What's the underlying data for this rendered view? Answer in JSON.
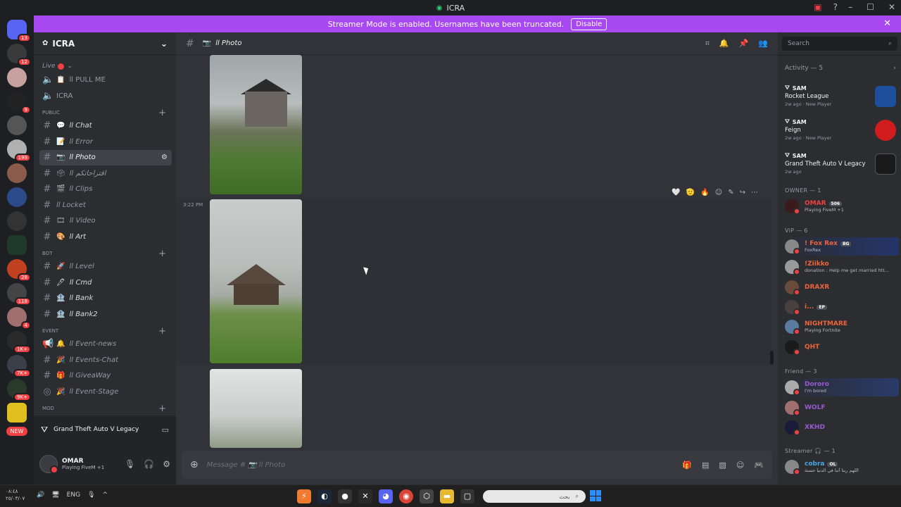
{
  "window": {
    "title": "ICRA"
  },
  "banner": {
    "text": "Streamer Mode is enabled. Usernames have been truncated.",
    "button": "Disable"
  },
  "guild_badges": [
    "13",
    "12",
    "9",
    "199",
    "28",
    "118",
    "4",
    "1K+",
    "7K+",
    "9K+"
  ],
  "guild_new": "NEW",
  "server": {
    "name": "ICRA"
  },
  "sidebar": {
    "live": {
      "label": "Live"
    },
    "voice": [
      {
        "label": "ll PULL ME"
      },
      {
        "label": "ICRA"
      }
    ],
    "public_cat": "PUBLIC",
    "public": [
      {
        "label": "ll Chat",
        "emoji": "💬"
      },
      {
        "label": "ll Error",
        "emoji": "📝"
      },
      {
        "label": "ll Photo",
        "emoji": "📷"
      },
      {
        "label": "ll اقتراحاتكم",
        "emoji": "🗳"
      },
      {
        "label": "ll Clips",
        "emoji": "🎬"
      },
      {
        "label": "ll Locket",
        "emoji": "🖼"
      },
      {
        "label": "ll Video",
        "emoji": "🎞"
      },
      {
        "label": "ll Art",
        "emoji": "🎨"
      }
    ],
    "bot_cat": "BOT",
    "bot": [
      {
        "label": "ll Level",
        "emoji": "🚀"
      },
      {
        "label": "ll Cmd",
        "emoji": "🖊"
      },
      {
        "label": "ll Bank",
        "emoji": "🏦"
      },
      {
        "label": "ll Bank2",
        "emoji": "🏦"
      }
    ],
    "event_cat": "EVENT",
    "event": [
      {
        "label": "ll Event-news",
        "emoji": "📢"
      },
      {
        "label": "ll Events-Chat",
        "emoji": "🎉"
      },
      {
        "label": "ll GiveaWay",
        "emoji": "🎁"
      },
      {
        "label": "ll Event-Stage",
        "emoji": "🎉"
      }
    ],
    "mod_cat": "MOD"
  },
  "activity_panel": {
    "game": "Grand Theft Auto V Legacy"
  },
  "user_panel": {
    "name": "OMAR",
    "status": "Playing FiveM +1"
  },
  "chat": {
    "channel": "ll Photo",
    "timestamp": "3:22 PM",
    "composer_placeholder": "Message # 📷 ll Photo"
  },
  "members": {
    "search_placeholder": "Search",
    "activity_head": "Activity — 5",
    "activity": [
      {
        "user": "SAM",
        "game": "Rocket League",
        "meta": "2w ago · New Player"
      },
      {
        "user": "SAM",
        "game": "Feign",
        "meta": "2w ago · New Player"
      },
      {
        "user": "SAM",
        "game": "Grand Theft Auto V Legacy",
        "meta": "2w ago"
      }
    ],
    "owner_head": "OWNER — 1",
    "owner": [
      {
        "name": "OMAR",
        "tag": "506",
        "status": "Playing FiveM +1",
        "color": "#f23f43"
      }
    ],
    "vip_head": "ViP — 6",
    "vip": [
      {
        "name": "! Fox Rex",
        "tag": "BG",
        "status": "FoxRex",
        "color": "#f0643c"
      },
      {
        "name": "!Ziikko",
        "status": "donation : Help me get married htt...",
        "color": "#f0643c"
      },
      {
        "name": "DRAXR",
        "status": "",
        "color": "#f0643c"
      },
      {
        "name": "i...",
        "tag": "EP",
        "status": "",
        "color": "#f0643c"
      },
      {
        "name": "NIGHTMARE",
        "status": "Playing Fortnite",
        "color": "#f0643c"
      },
      {
        "name": "QHT",
        "status": "",
        "color": "#f0643c"
      }
    ],
    "friend_head": "Friend — 3",
    "friend": [
      {
        "name": "Dororo",
        "status": "I'm bored",
        "color": "#9b59d0"
      },
      {
        "name": "WOLF",
        "status": "",
        "color": "#9b59d0"
      },
      {
        "name": "XKHD",
        "status": "",
        "color": "#9b59d0"
      }
    ],
    "streamer_head": "Streamer 🎧 — 1",
    "streamer": [
      {
        "name": "cobra",
        "tag": "OL",
        "status": "اللهم ربنا آتنا في الدنيا حسنة",
        "color": "#4aa8e0"
      }
    ]
  },
  "taskbar": {
    "time": "٠٨:٤٨",
    "date": "٢٥/٠٣/٠٧",
    "lang": "ENG",
    "search_placeholder": "بحث"
  }
}
